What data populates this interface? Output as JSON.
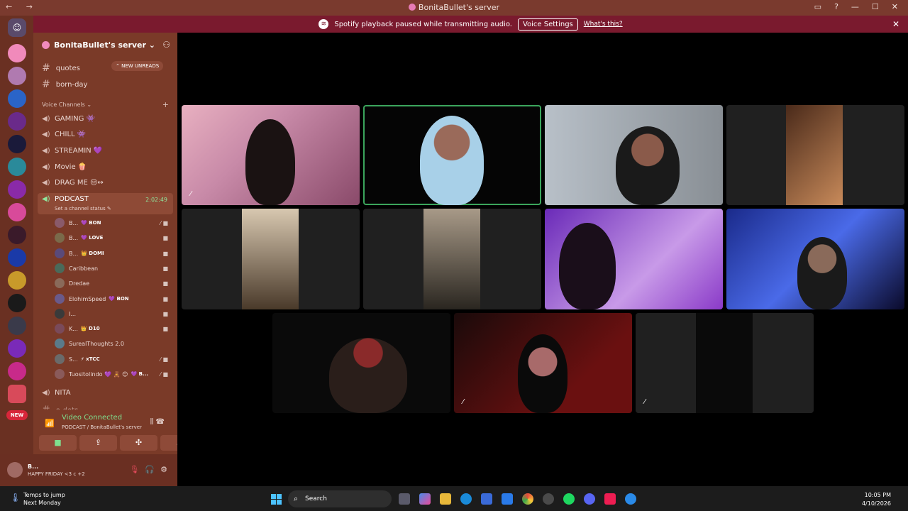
{
  "window": {
    "title": "BonitaBullet's server",
    "nav": "← →"
  },
  "banner": {
    "message": "Spotify playback paused while transmitting audio.",
    "voice_settings": "Voice Settings",
    "whats_this": "What's this?"
  },
  "server": {
    "name": "BonitaBullet's server ⌄",
    "new_unreads": "⌃ NEW UNREADS"
  },
  "text_channels": [
    {
      "name": "quotes"
    },
    {
      "name": "born-day"
    }
  ],
  "voice_category": "Voice Channels ⌄",
  "voice_channels": [
    {
      "name": "GAMING 👾"
    },
    {
      "name": "CHILL 👾"
    },
    {
      "name": "STREAMIN 💜"
    },
    {
      "name": "Movie 🍿"
    },
    {
      "name": "DRAG ME 😑↔"
    }
  ],
  "active_channel": {
    "name": "PODCAST",
    "status": "Set a channel status ✎",
    "timer": "2:02:49"
  },
  "members": [
    {
      "name": "B...",
      "tag": "💜 BON"
    },
    {
      "name": "B...",
      "tag": "💜 LOVE"
    },
    {
      "name": "B...",
      "tag": "👑 DOMI"
    },
    {
      "name": "Caribbean",
      "tag": ""
    },
    {
      "name": "Dredae",
      "tag": ""
    },
    {
      "name": "ElohimSpeed",
      "tag": "💜 BON"
    },
    {
      "name": "I...",
      "tag": ""
    },
    {
      "name": "K...",
      "tag": "👑 D10"
    },
    {
      "name": "SurealThoughts 2.0",
      "tag": ""
    },
    {
      "name": "S...",
      "tag": "⚡ xTCC"
    },
    {
      "name": "Tuositolindo 💜 🧸 😊",
      "tag": "💜 B..."
    }
  ],
  "after_channels": [
    {
      "name": "NITA"
    },
    {
      "name": "o-dots"
    }
  ],
  "voice_panel": {
    "status": "Video Connected",
    "location": "PODCAST / BonitaBullet's server"
  },
  "user": {
    "name": "B...",
    "status": "HAPPY FRIDAY <3 c +2"
  },
  "server_badges": {
    "new": "NEW"
  },
  "taskbar": {
    "weather_line1": "Temps to jump",
    "weather_line2": "Next Monday",
    "search": "Search",
    "time": "10:05 PM",
    "date": "4/10/2026"
  },
  "colors": {
    "titlebar": "#7a3a2e",
    "banner": "#7a1a2e",
    "sidebar": "#7a3a28",
    "connected": "#7fe08f",
    "speaking_border": "#3ba55c"
  }
}
